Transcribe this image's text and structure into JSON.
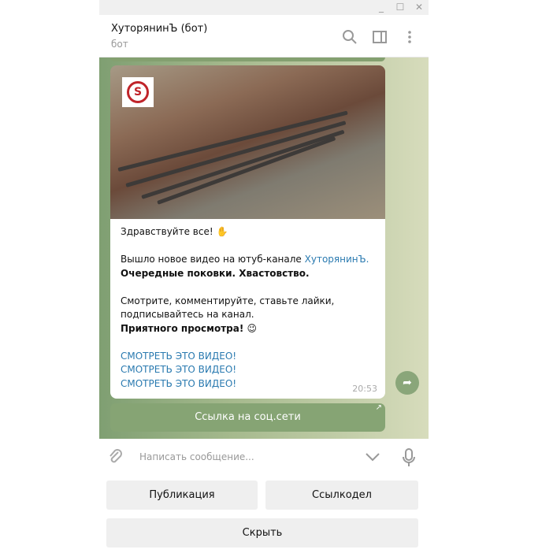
{
  "window": {
    "controls": [
      "minimize",
      "maximize",
      "close"
    ]
  },
  "header": {
    "title": "ХуторянинЪ (бот)",
    "subtitle": "бот",
    "icons": [
      "search-icon",
      "sidebar-toggle-icon",
      "more-icon"
    ]
  },
  "message": {
    "greeting": "Здравствуйте все! ✋",
    "line1_prefix": "Вышло новое видео на ютуб-канале ",
    "channel_link": "ХуторянинЪ.",
    "line2": "Очередные поковки. Хвастовство.",
    "line3": "Смотрите, комментируйте, ставьте лайки, подписывайтесь на канал.",
    "line4": "Приятного просмотра! 😉",
    "links": [
      "СМОТРЕТЬ ЭТО ВИДЕО!",
      "СМОТРЕТЬ ЭТО ВИДЕО!",
      "СМОТРЕТЬ ЭТО ВИДЕО!"
    ],
    "time": "20:53",
    "inline_button": "Ссылка на соц.сети"
  },
  "composer": {
    "placeholder": "Написать сообщение..."
  },
  "keyboard": {
    "buttons": [
      "Публикация",
      "Ссылкодел",
      "Скрыть"
    ]
  },
  "colors": {
    "link": "#2a7ab0",
    "accent": "#86a474"
  }
}
